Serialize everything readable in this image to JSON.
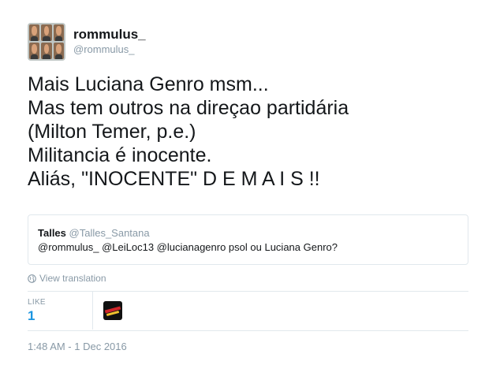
{
  "author": {
    "display_name": "rommulus_",
    "handle": "@rommulus_",
    "avatar": "avatar-photo-grid"
  },
  "tweet": {
    "lines": [
      "Mais Luciana Genro msm...",
      "Mas tem outros na direçao partidária",
      "(Milton Temer, p.e.)",
      "Militancia é inocente.",
      "Aliás, \"INOCENTE\" D E M A I S !!"
    ]
  },
  "quoted_tweet": {
    "display_name": "Talles",
    "handle": "@Talles_Santana",
    "text": "@rommulus_ @LeiLoc13 @lucianagenro psol ou Luciana Genro?"
  },
  "translation": {
    "label": "View translation",
    "icon": "globe-icon"
  },
  "stats": {
    "like_label": "LIKE",
    "like_count": "1"
  },
  "timestamp": "1:48 AM - 1 Dec 2016",
  "colors": {
    "primary_text": "#14171a",
    "secondary_text": "#8899a6",
    "accent": "#1b95e0",
    "border": "#e1e8ed"
  }
}
